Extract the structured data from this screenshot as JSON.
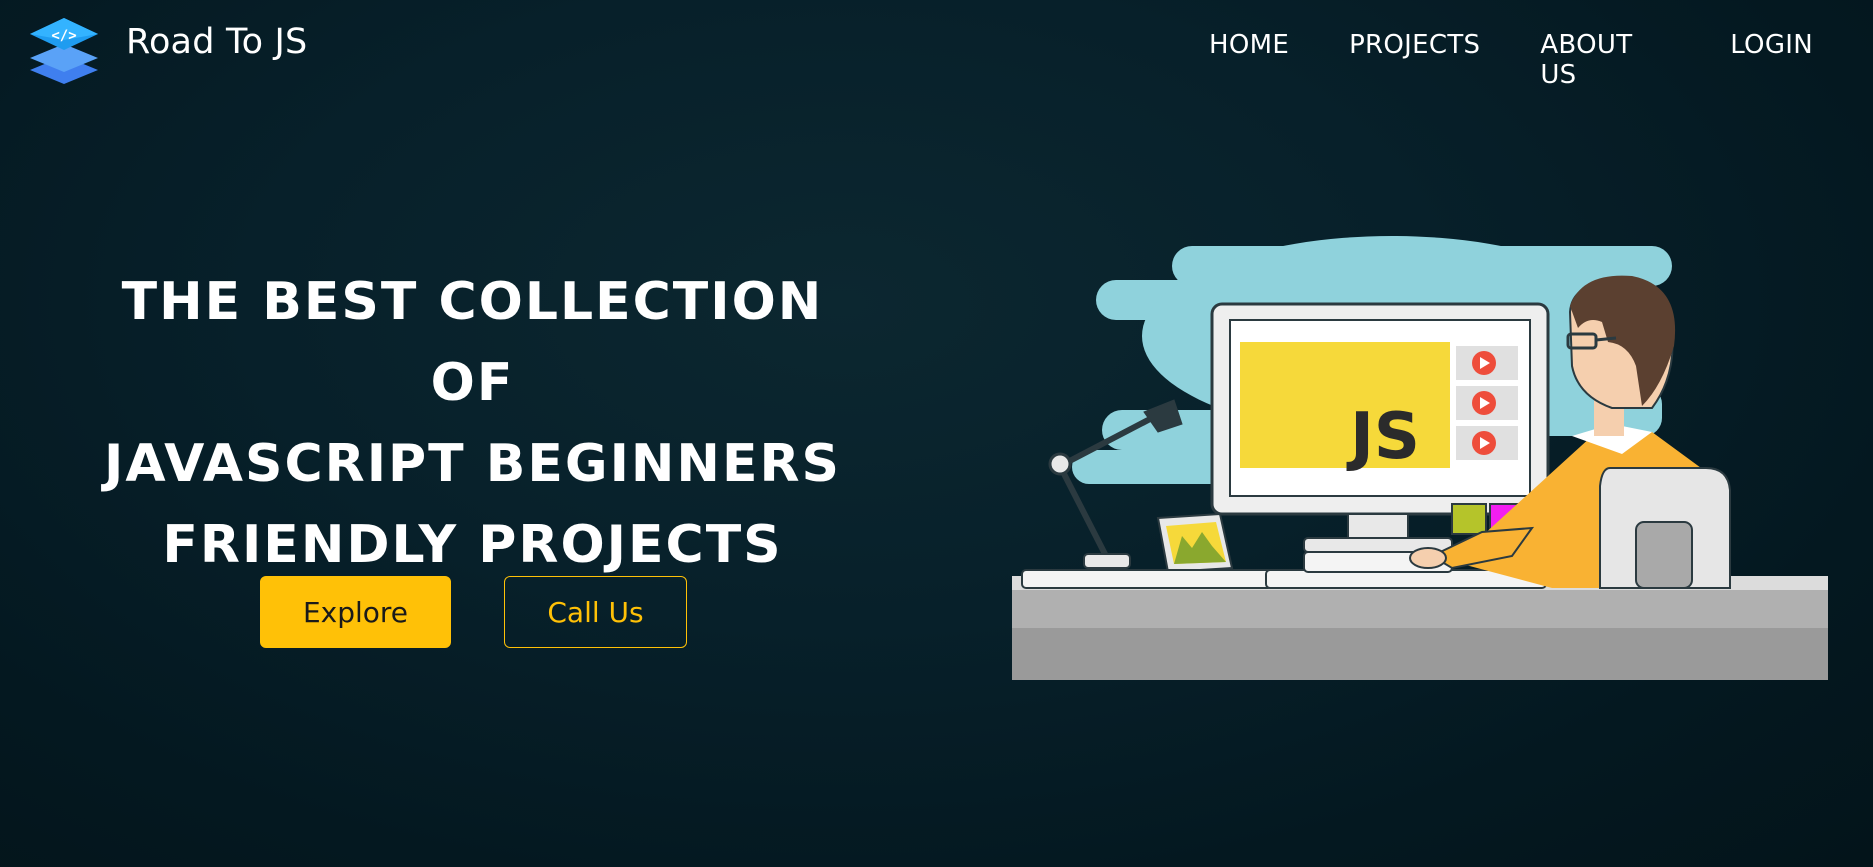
{
  "brand": {
    "name": "Road To JS",
    "logo_icon": "layers-code-icon"
  },
  "nav": {
    "items": [
      {
        "label": "HOME"
      },
      {
        "label": "PROJECTS"
      },
      {
        "label": "ABOUT US"
      },
      {
        "label": "LOGIN"
      }
    ]
  },
  "hero": {
    "title_lines": [
      "THE BEST COLLECTION OF",
      "JAVASCRIPT BEGINNERS",
      "FRIENDLY PROJECTS"
    ],
    "primary_button": "Explore",
    "secondary_button": "Call Us"
  },
  "illustration": {
    "screen_label": "JS",
    "description_icon": "developer-at-computer-illustration"
  },
  "colors": {
    "accent": "#ffc107",
    "background": "#061a20",
    "text": "#ffffff"
  }
}
